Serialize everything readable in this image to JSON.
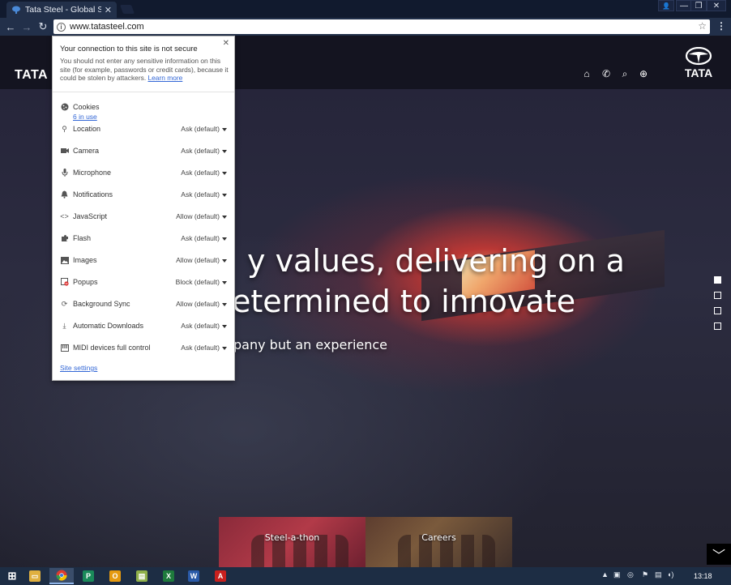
{
  "browser": {
    "tab": {
      "title": "Tata Steel - Global Steel",
      "close_glyph": "✕"
    },
    "window_controls": {
      "user": "👤",
      "minimize": "—",
      "restore": "❐",
      "close": "✕"
    },
    "omnibox": {
      "url": "www.tatasteel.com",
      "info_glyph": "i",
      "star_glyph": "☆"
    },
    "nav": {
      "back": "←",
      "forward": "→",
      "reload": "↻",
      "menu": "⋮"
    }
  },
  "site": {
    "logo_left": "TATA",
    "logo_right": "TATA",
    "header_icons": [
      {
        "name": "home-icon",
        "glyph": "⌂"
      },
      {
        "name": "phone-icon",
        "glyph": "✆"
      },
      {
        "name": "search-icon",
        "glyph": "⌕"
      },
      {
        "name": "globe-icon",
        "glyph": "⊕"
      }
    ],
    "hero": {
      "line1": "y values, delivering on a",
      "line2": "etermined to innovate",
      "subline": "pany but an experience"
    },
    "slide_dots": [
      true,
      false,
      false,
      false
    ],
    "tiles": [
      {
        "label": "Steel-a-thon"
      },
      {
        "label": "Careers"
      }
    ],
    "scroll_glyph": "﹀"
  },
  "site_info_popup": {
    "close_glyph": "✕",
    "title": "Your connection to this site is not secure",
    "description": "You should not enter any sensitive information on this site (for example, passwords or credit cards), because it could be stolen by attackers.",
    "learn_more": "Learn more",
    "cookies": {
      "label": "Cookies",
      "in_use": "6 in use"
    },
    "permissions": [
      {
        "name": "location",
        "icon": "location-icon",
        "glyph": "⚲",
        "label": "Location",
        "value": "Ask (default)"
      },
      {
        "name": "camera",
        "icon": "camera-icon",
        "glyph": "■",
        "label": "Camera",
        "value": "Ask (default)"
      },
      {
        "name": "microphone",
        "icon": "microphone-icon",
        "glyph": "🎙",
        "label": "Microphone",
        "value": "Ask (default)"
      },
      {
        "name": "notifications",
        "icon": "bell-icon",
        "glyph": "🔔",
        "label": "Notifications",
        "value": "Ask (default)"
      },
      {
        "name": "javascript",
        "icon": "code-icon",
        "glyph": "<>",
        "label": "JavaScript",
        "value": "Allow (default)"
      },
      {
        "name": "flash",
        "icon": "puzzle-icon",
        "glyph": "✱",
        "label": "Flash",
        "value": "Ask (default)"
      },
      {
        "name": "images",
        "icon": "image-icon",
        "glyph": "▣",
        "label": "Images",
        "value": "Allow (default)"
      },
      {
        "name": "popups",
        "icon": "popup-blocked-icon",
        "glyph": "⧉",
        "label": "Popups",
        "value": "Block (default)"
      },
      {
        "name": "background-sync",
        "icon": "sync-icon",
        "glyph": "⟳",
        "label": "Background Sync",
        "value": "Allow (default)"
      },
      {
        "name": "automatic-downloads",
        "icon": "download-icon",
        "glyph": "⤓",
        "label": "Automatic Downloads",
        "value": "Ask (default)"
      },
      {
        "name": "midi",
        "icon": "midi-icon",
        "glyph": "▥",
        "label": "MIDI devices full control",
        "value": "Ask (default)"
      }
    ],
    "site_settings": "Site settings"
  },
  "taskbar": {
    "apps": [
      {
        "name": "start-button",
        "glyph": "⊞",
        "color": "#1d2d44"
      },
      {
        "name": "file-explorer-icon",
        "glyph": "▭",
        "color": "#e0b040"
      },
      {
        "name": "chrome-icon",
        "glyph": "●",
        "color": "#4caf50"
      },
      {
        "name": "publisher-icon",
        "glyph": "P",
        "color": "#1a8a5a"
      },
      {
        "name": "outlook-icon",
        "glyph": "O",
        "color": "#e59a10"
      },
      {
        "name": "folder-icon",
        "glyph": "▤",
        "color": "#8fb04a"
      },
      {
        "name": "excel-icon",
        "glyph": "X",
        "color": "#1e7a3c"
      },
      {
        "name": "word-icon",
        "glyph": "W",
        "color": "#2a5aa8"
      },
      {
        "name": "pdf-icon",
        "glyph": "A",
        "color": "#c8201e"
      }
    ],
    "clock": "13:18"
  },
  "colors": {
    "link": "#3367d6",
    "taskbar": "#1d2d44",
    "tab_strip": "#111a2e"
  }
}
